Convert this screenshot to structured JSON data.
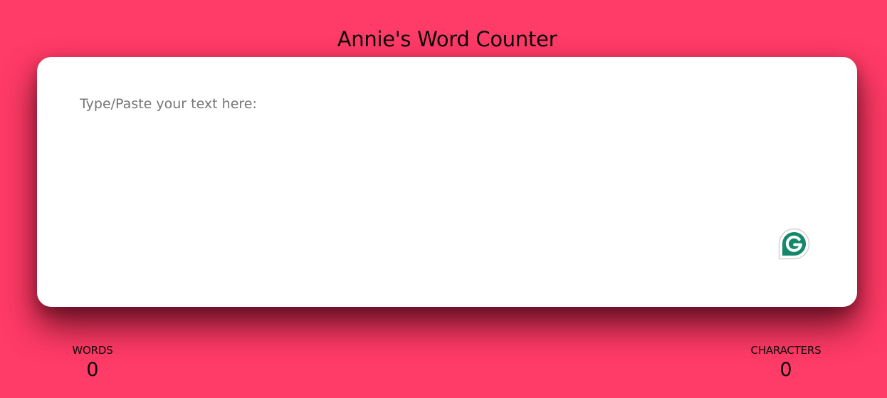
{
  "header": {
    "title": "Annie's Word Counter"
  },
  "editor": {
    "placeholder": "Type/Paste your text here:",
    "value": ""
  },
  "stats": {
    "words_label": "WORDS",
    "words_value": "0",
    "characters_label": "CHARACTERS",
    "characters_value": "0"
  },
  "colors": {
    "background": "#ff3b67",
    "card": "#ffffff",
    "grammarly_brand": "#15876c"
  },
  "icons": {
    "grammarly": "grammarly-icon"
  }
}
